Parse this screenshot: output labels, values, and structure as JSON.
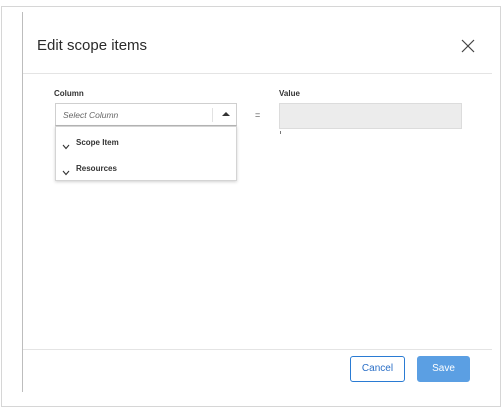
{
  "dialog": {
    "title": "Edit scope items",
    "close_icon": "close-icon"
  },
  "form": {
    "column_label": "Column",
    "value_label": "Value",
    "column_select": {
      "placeholder": "Select Column",
      "caret_icon": "caret-up-icon"
    },
    "operator": "=",
    "value_input": {
      "value": ""
    }
  },
  "dropdown": {
    "items": [
      {
        "label": "Scope Item",
        "icon": "chevron-down-icon"
      },
      {
        "label": "Resources",
        "icon": "chevron-down-icon"
      }
    ]
  },
  "footer": {
    "cancel_label": "Cancel",
    "save_label": "Save"
  },
  "colors": {
    "primary": "#5b9fe3",
    "cancel_border": "#2a7bd3",
    "input_background": "#ececec"
  }
}
